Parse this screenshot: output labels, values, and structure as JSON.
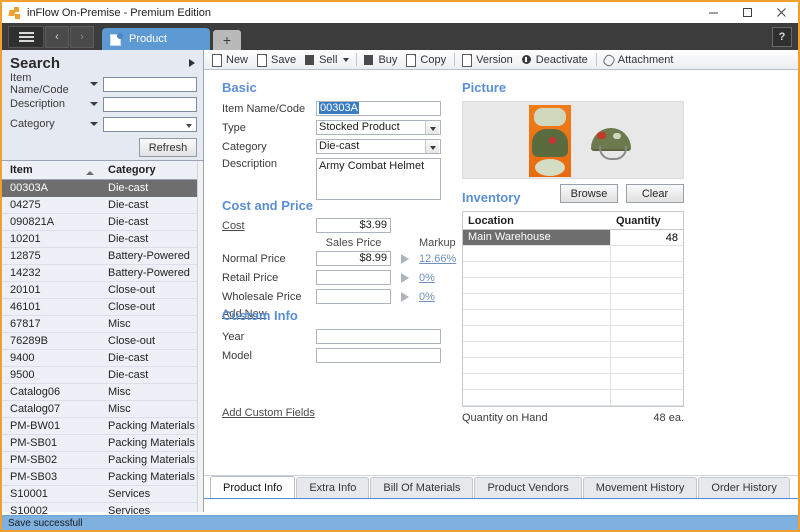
{
  "window": {
    "title": "inFlow On-Premise - Premium Edition",
    "app_icon": "inflow-logo-icon",
    "minimize": "minimize-icon",
    "maximize": "maximize-icon",
    "close": "close-icon"
  },
  "tabstrip": {
    "menu_icon": "hamburger-icon",
    "back_label": "‹",
    "forward_label": "›",
    "active_tab": "Product",
    "new_tab_label": "+",
    "help_label": "?"
  },
  "toolbar": {
    "buttons": [
      {
        "label": "New",
        "icon": "new-document-icon",
        "caret": false
      },
      {
        "label": "Save",
        "icon": "save-icon",
        "caret": false
      },
      {
        "label": "Sell",
        "icon": "sell-icon",
        "caret": true
      },
      {
        "label": "Buy",
        "icon": "buy-icon",
        "caret": false
      },
      {
        "label": "Copy",
        "icon": "copy-icon",
        "caret": false
      },
      {
        "label": "Version",
        "icon": "version-icon",
        "caret": false
      },
      {
        "label": "Deactivate",
        "icon": "deactivate-icon",
        "caret": false
      },
      {
        "label": "Attachment",
        "icon": "attachment-icon",
        "caret": false
      }
    ]
  },
  "search": {
    "title": "Search",
    "collapse_icon": "collapse-arrow-icon",
    "fields": [
      {
        "label": "Item Name/Code",
        "value": "",
        "type": "text"
      },
      {
        "label": "Description",
        "value": "",
        "type": "text"
      },
      {
        "label": "Category",
        "value": "",
        "type": "combo"
      }
    ],
    "refresh_label": "Refresh"
  },
  "item_list": {
    "columns": [
      "Item",
      "Category"
    ],
    "sort_column": "Item",
    "sort_direction": "asc",
    "selected_index": 0,
    "rows": [
      {
        "item": "00303A",
        "category": "Die-cast"
      },
      {
        "item": "04275",
        "category": "Die-cast"
      },
      {
        "item": "090821A",
        "category": "Die-cast"
      },
      {
        "item": "10201",
        "category": "Die-cast"
      },
      {
        "item": "12875",
        "category": "Battery-Powered"
      },
      {
        "item": "14232",
        "category": "Battery-Powered"
      },
      {
        "item": "20101",
        "category": "Close-out"
      },
      {
        "item": "46101",
        "category": "Close-out"
      },
      {
        "item": "67817",
        "category": "Misc"
      },
      {
        "item": "76289B",
        "category": "Close-out"
      },
      {
        "item": "9400",
        "category": "Die-cast"
      },
      {
        "item": "9500",
        "category": "Die-cast"
      },
      {
        "item": "Catalog06",
        "category": "Misc"
      },
      {
        "item": "Catalog07",
        "category": "Misc"
      },
      {
        "item": "PM-BW01",
        "category": "Packing Materials"
      },
      {
        "item": "PM-SB01",
        "category": "Packing Materials"
      },
      {
        "item": "PM-SB02",
        "category": "Packing Materials"
      },
      {
        "item": "PM-SB03",
        "category": "Packing Materials"
      },
      {
        "item": "S10001",
        "category": "Services"
      },
      {
        "item": "S10002",
        "category": "Services"
      }
    ]
  },
  "basic": {
    "section_title": "Basic",
    "item_name_label": "Item Name/Code",
    "item_name_value": "00303A",
    "type_label": "Type",
    "type_value": "Stocked Product",
    "category_label": "Category",
    "category_value": "Die-cast",
    "description_label": "Description",
    "description_value": "Army Combat Helmet"
  },
  "cost_and_price": {
    "section_title": "Cost and Price",
    "cost_label": "Cost",
    "cost_value": "$3.99",
    "sales_price_header": "Sales Price",
    "markup_header": "Markup",
    "rows": [
      {
        "label": "Normal Price",
        "price": "$8.99",
        "markup": "12.66%"
      },
      {
        "label": "Retail Price",
        "price": "",
        "markup": "0%"
      },
      {
        "label": "Wholesale Price",
        "price": "",
        "markup": "0%"
      }
    ],
    "add_new_label": "Add New"
  },
  "custom_info": {
    "section_title": "Custom Info",
    "fields": [
      {
        "label": "Year",
        "value": ""
      },
      {
        "label": "Model",
        "value": ""
      }
    ],
    "add_custom_fields_label": "Add Custom Fields"
  },
  "picture": {
    "section_title": "Picture",
    "image_alt": "army-combat-helmet-product-photo",
    "browse_label": "Browse",
    "clear_label": "Clear"
  },
  "inventory": {
    "section_title": "Inventory",
    "columns": [
      "Location",
      "Quantity"
    ],
    "rows": [
      {
        "location": "Main Warehouse",
        "quantity": "48"
      },
      {
        "location": "",
        "quantity": ""
      },
      {
        "location": "",
        "quantity": ""
      },
      {
        "location": "",
        "quantity": ""
      },
      {
        "location": "",
        "quantity": ""
      },
      {
        "location": "",
        "quantity": ""
      },
      {
        "location": "",
        "quantity": ""
      },
      {
        "location": "",
        "quantity": ""
      },
      {
        "location": "",
        "quantity": ""
      },
      {
        "location": "",
        "quantity": ""
      },
      {
        "location": "",
        "quantity": ""
      }
    ],
    "selected_index": 0,
    "quantity_on_hand_label": "Quantity on Hand",
    "quantity_on_hand_value": "48 ea."
  },
  "bottom_tabs": {
    "active": "Product Info",
    "tabs": [
      "Product Info",
      "Extra Info",
      "Bill Of Materials",
      "Product Vendors",
      "Movement History",
      "Order History"
    ]
  },
  "status_bar": {
    "message": "Save successfull"
  },
  "colors": {
    "window_border": "#f0a030",
    "accent_blue": "#5b8fd4",
    "section_heading": "#5b8fd4",
    "selection_gray": "#6e6e6e",
    "selection_blue": "#3a7cc4",
    "status_bar": "#7eb0e0",
    "tabstrip_dark": "#3c3c3c"
  }
}
